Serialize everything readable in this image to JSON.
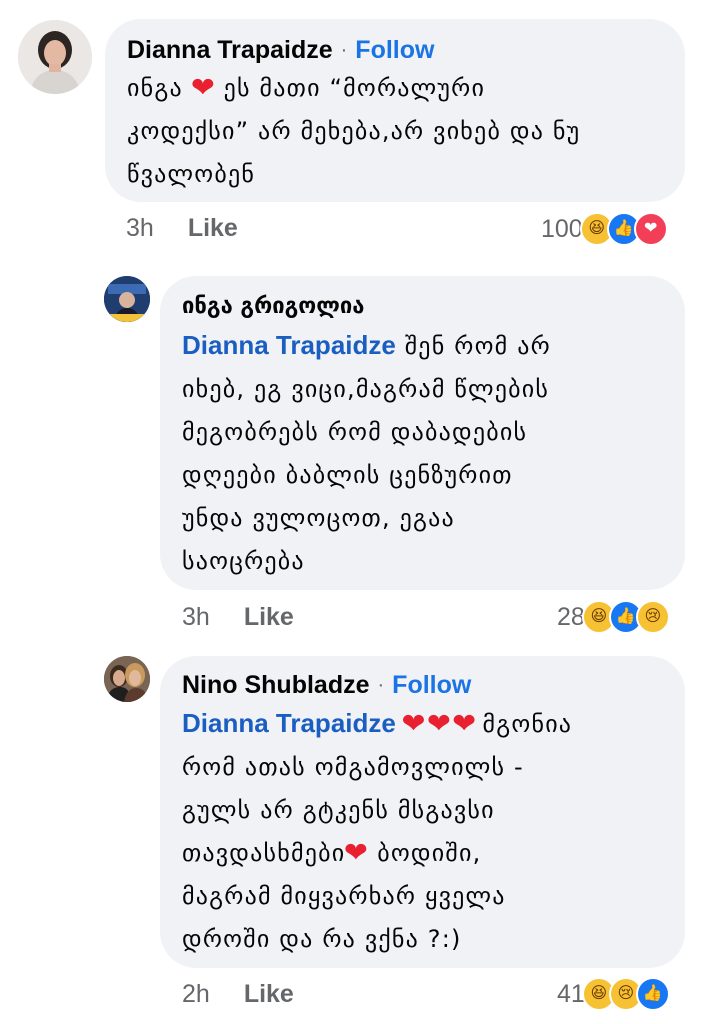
{
  "comments": [
    {
      "author": "Dianna Trapaidze",
      "follow": "Follow",
      "text_lines": [
        {
          "pre": "ინგა",
          "heart": "❤",
          "post": "ეს მათი “მორალური"
        },
        {
          "text": "კოდექსი” არ მეხება,არ ვიხებ და ნუ"
        },
        {
          "text": "წვალობენ"
        }
      ],
      "time": "3h",
      "like": "Like",
      "reaction_count": "100",
      "reactions": [
        "haha-icon",
        "like-icon",
        "love-icon"
      ]
    },
    {
      "author": "ინგა გრიგოლია",
      "mention": "Dianna Trapaidze",
      "text_lines": [
        {
          "after_mention": "შენ რომ  არ"
        },
        {
          "text": "იხებ, ეგ ვიცი,მაგრამ წლების"
        },
        {
          "text": "მეგობრებს რომ დაბადების"
        },
        {
          "text": "დღეები ბაბლის ცენზურით"
        },
        {
          "text": "უნდა ვულოცოთ, ეგაა"
        },
        {
          "text": "საოცრება"
        }
      ],
      "time": "3h",
      "like": "Like",
      "reaction_count": "28",
      "reactions": [
        "haha-icon",
        "like-icon",
        "sad-icon"
      ]
    },
    {
      "author": "Nino Shubladze",
      "follow": "Follow",
      "mention": "Dianna Trapaidze",
      "hearts": "❤❤❤",
      "text_lines": [
        {
          "after_mention": "მგონია"
        },
        {
          "text": "რომ ათას ომგამოვლილს -"
        },
        {
          "text": "გულს არ გტკენს მსგავსი"
        },
        {
          "pre": "თავდასხმები",
          "heart": "❤",
          "post": "ბოდიში,"
        },
        {
          "text": "მაგრამ მიყვარხარ ყველა"
        },
        {
          "text": "დროში და რა ვქნა ?:)"
        }
      ],
      "time": "2h",
      "like": "Like",
      "reaction_count": "41",
      "reactions": [
        "haha-icon",
        "sad-icon",
        "like-icon"
      ]
    }
  ],
  "colors": {
    "bubble": "#f0f2f5",
    "mention": "#1b5ec2",
    "follow": "#1b74e4",
    "meta": "#65676b"
  }
}
